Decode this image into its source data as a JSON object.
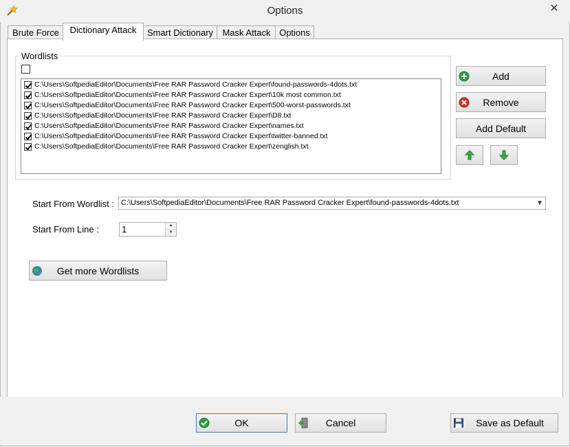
{
  "window": {
    "title": "Options",
    "close_glyph": "✕"
  },
  "tabs": [
    {
      "label": "Brute Force"
    },
    {
      "label": "Dictionary Attack"
    },
    {
      "label": "Smart Dictionary"
    },
    {
      "label": "Mask Attack"
    },
    {
      "label": "Options"
    }
  ],
  "active_tab": "Dictionary Attack",
  "wordlists": {
    "group_label": "Wordlists",
    "select_all_checked": false,
    "items": [
      {
        "path": "C:\\Users\\SoftpediaEditor\\Documents\\Free RAR Password Cracker Expert\\found-passwords-4dots.txt",
        "checked": true
      },
      {
        "path": "C:\\Users\\SoftpediaEditor\\Documents\\Free RAR Password Cracker Expert\\10k most common.txt",
        "checked": true
      },
      {
        "path": "C:\\Users\\SoftpediaEditor\\Documents\\Free RAR Password Cracker Expert\\500-worst-passwords.txt",
        "checked": true
      },
      {
        "path": "C:\\Users\\SoftpediaEditor\\Documents\\Free RAR Password Cracker Expert\\D8.txt",
        "checked": true
      },
      {
        "path": "C:\\Users\\SoftpediaEditor\\Documents\\Free RAR Password Cracker Expert\\names.txt",
        "checked": true
      },
      {
        "path": "C:\\Users\\SoftpediaEditor\\Documents\\Free RAR Password Cracker Expert\\twitter-banned.txt",
        "checked": true
      },
      {
        "path": "C:\\Users\\SoftpediaEditor\\Documents\\Free RAR Password Cracker Expert\\zenglish.txt",
        "checked": true
      }
    ]
  },
  "buttons": {
    "add": "Add",
    "remove": "Remove",
    "add_default": "Add Default",
    "get_more": "Get more Wordlists",
    "ok": "OK",
    "cancel": "Cancel",
    "save_default": "Save as Default"
  },
  "start_from_wordlist": {
    "label": "Start From Wordlist :",
    "value": "C:\\Users\\SoftpediaEditor\\Documents\\Free RAR Password Cracker Expert\\found-passwords-4dots.txt"
  },
  "start_from_line": {
    "label": "Start From Line :",
    "value": "1"
  },
  "icons": {
    "add": "plus-circle-icon",
    "remove": "x-circle-icon",
    "move_up": "arrow-up-icon",
    "move_down": "arrow-down-icon",
    "get_more": "globe-icon",
    "ok": "check-circle-icon",
    "cancel": "exit-door-icon",
    "save": "floppy-disk-icon"
  },
  "colors": {
    "add_green": "#2ea043",
    "remove_red": "#d93025",
    "arrow_green": "#3cb043",
    "accent_blue": "#3c7fb1"
  }
}
